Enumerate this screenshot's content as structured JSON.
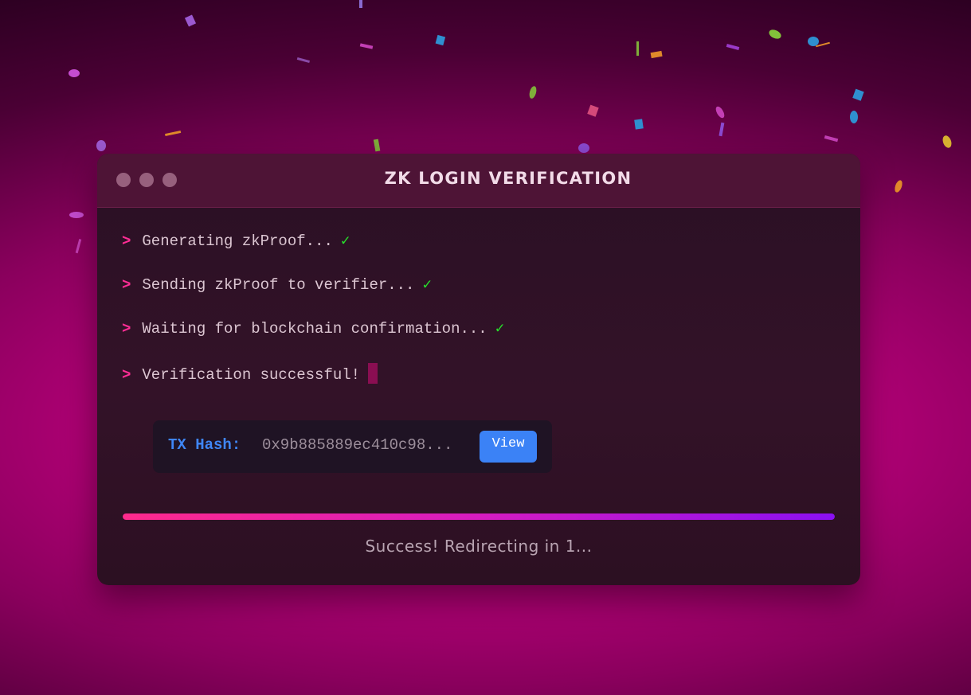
{
  "window": {
    "title": "ZK LOGIN VERIFICATION"
  },
  "terminal": {
    "prompt_symbol": ">",
    "check_symbol": "✓",
    "lines": [
      {
        "text": "Generating zkProof...",
        "done": true
      },
      {
        "text": "Sending zkProof to verifier...",
        "done": true
      },
      {
        "text": "Waiting for blockchain confirmation...",
        "done": true
      },
      {
        "text": "Verification successful!",
        "done": false
      }
    ]
  },
  "transaction": {
    "label": "TX Hash:",
    "hash": "0x9b885889ec410c98...",
    "view_label": "View"
  },
  "progress": {
    "value_percent": 100
  },
  "status": {
    "message": "Success! Redirecting in 1..."
  },
  "colors": {
    "accent_pink": "#ff2d95",
    "check_green": "#27e02b",
    "link_blue": "#3b82f6"
  }
}
